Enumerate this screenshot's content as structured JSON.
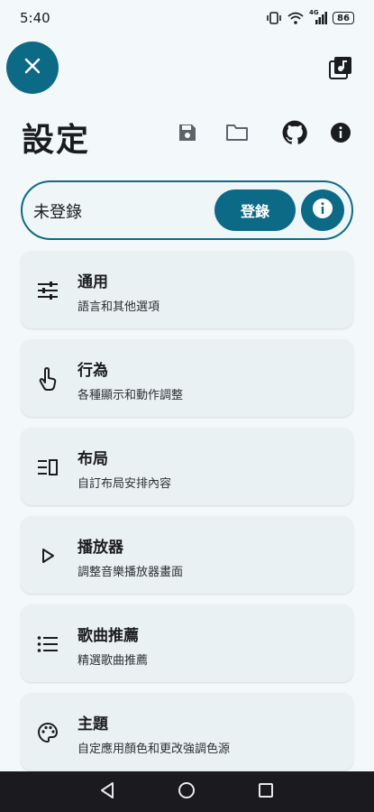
{
  "status_bar": {
    "time": "5:40",
    "network": "4G",
    "battery": "86",
    "icons": [
      "vibrate-icon",
      "wifi-icon",
      "cellular-signal-icon",
      "battery-icon"
    ]
  },
  "header": {
    "title": "設定",
    "close_icon": "close-icon",
    "library_icon": "music-library-icon",
    "actions": [
      "save-icon",
      "folder-icon",
      "github-icon",
      "info-icon"
    ]
  },
  "login": {
    "status": "未登錄",
    "button_label": "登錄",
    "info_icon": "info-icon"
  },
  "settings": [
    {
      "title": "通用",
      "subtitle": "語言和其他選項",
      "icon": "tune-icon"
    },
    {
      "title": "行為",
      "subtitle": "各種顯示和動作調整",
      "icon": "touch-icon"
    },
    {
      "title": "布局",
      "subtitle": "自訂布局安排內容",
      "icon": "layout-icon"
    },
    {
      "title": "播放器",
      "subtitle": "調整音樂播放器畫面",
      "icon": "play-icon"
    },
    {
      "title": "歌曲推薦",
      "subtitle": "精選歌曲推薦",
      "icon": "list-icon"
    },
    {
      "title": "主題",
      "subtitle": "自定應用顏色和更改強調色源",
      "icon": "palette-icon"
    }
  ],
  "nav_bar": [
    "back-icon",
    "home-icon",
    "recents-icon"
  ],
  "colors": {
    "accent": "#0d6a86",
    "background": "#f3f9fb",
    "card": "#eaf1f3"
  }
}
